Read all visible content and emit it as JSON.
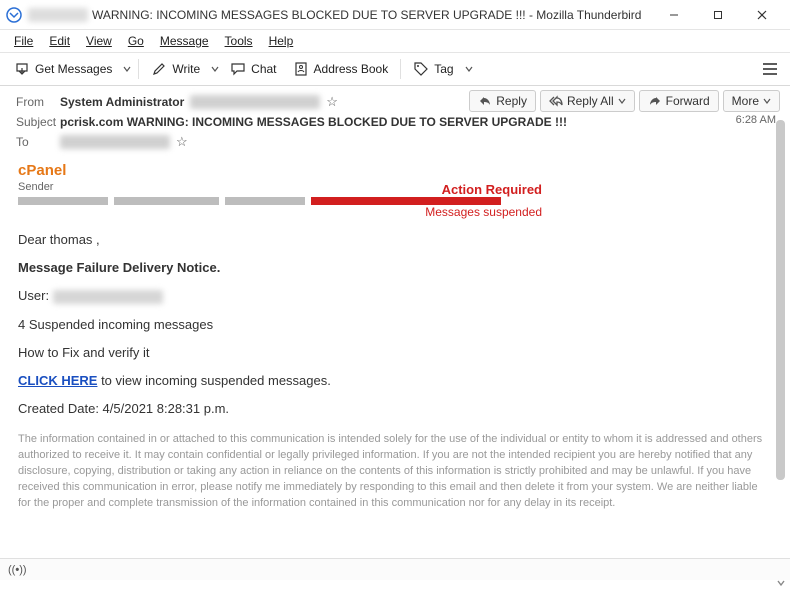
{
  "window": {
    "title": "WARNING: INCOMING MESSAGES BLOCKED DUE TO SERVER UPGRADE !!! - Mozilla Thunderbird"
  },
  "menubar": {
    "file": "File",
    "edit": "Edit",
    "view": "View",
    "go": "Go",
    "message": "Message",
    "tools": "Tools",
    "help": "Help"
  },
  "toolbar": {
    "get_messages": "Get Messages",
    "write": "Write",
    "chat": "Chat",
    "address_book": "Address Book",
    "tag": "Tag"
  },
  "header": {
    "from_label": "From",
    "from_name": "System Administrator",
    "subject_label": "Subject",
    "subject": "pcrisk.com WARNING: INCOMING MESSAGES BLOCKED DUE TO SERVER UPGRADE !!!",
    "to_label": "To",
    "time": "6:28 AM",
    "reply": "Reply",
    "reply_all": "Reply All",
    "forward": "Forward",
    "more": "More"
  },
  "body": {
    "brand": "cPanel",
    "sender_label": "Sender",
    "action_required": "Action Required",
    "messages_suspended": "Messages suspended",
    "greeting": "Dear thomas ,",
    "notice": "Message Failure Delivery Notice.",
    "user_label": "User:",
    "suspended_line": "4 Suspended incoming messages",
    "howto": "How to Fix and verify it",
    "click_here": "CLICK HERE",
    "click_rest": "  to view incoming suspended messages.",
    "created_label": "Created Date:  4/5/2021 8:28:31 p.m.",
    "disclaimer": "The information contained in or attached to this communication is intended solely for the use of the individual or entity to whom it is addressed and others authorized to receive it. It may contain confidential or legally privileged information. If you are not the intended recipient you are hereby notified that any disclosure, copying, distribution or taking any action in reliance on the contents of this information is strictly prohibited and may be unlawful. If you have received this communication in error, please notify me immediately by responding to this email and then delete it from your system. We are neither liable for the proper and complete transmission of the information contained in this communication nor for any delay in its receipt."
  },
  "status": {
    "online_icon": "((•))"
  }
}
